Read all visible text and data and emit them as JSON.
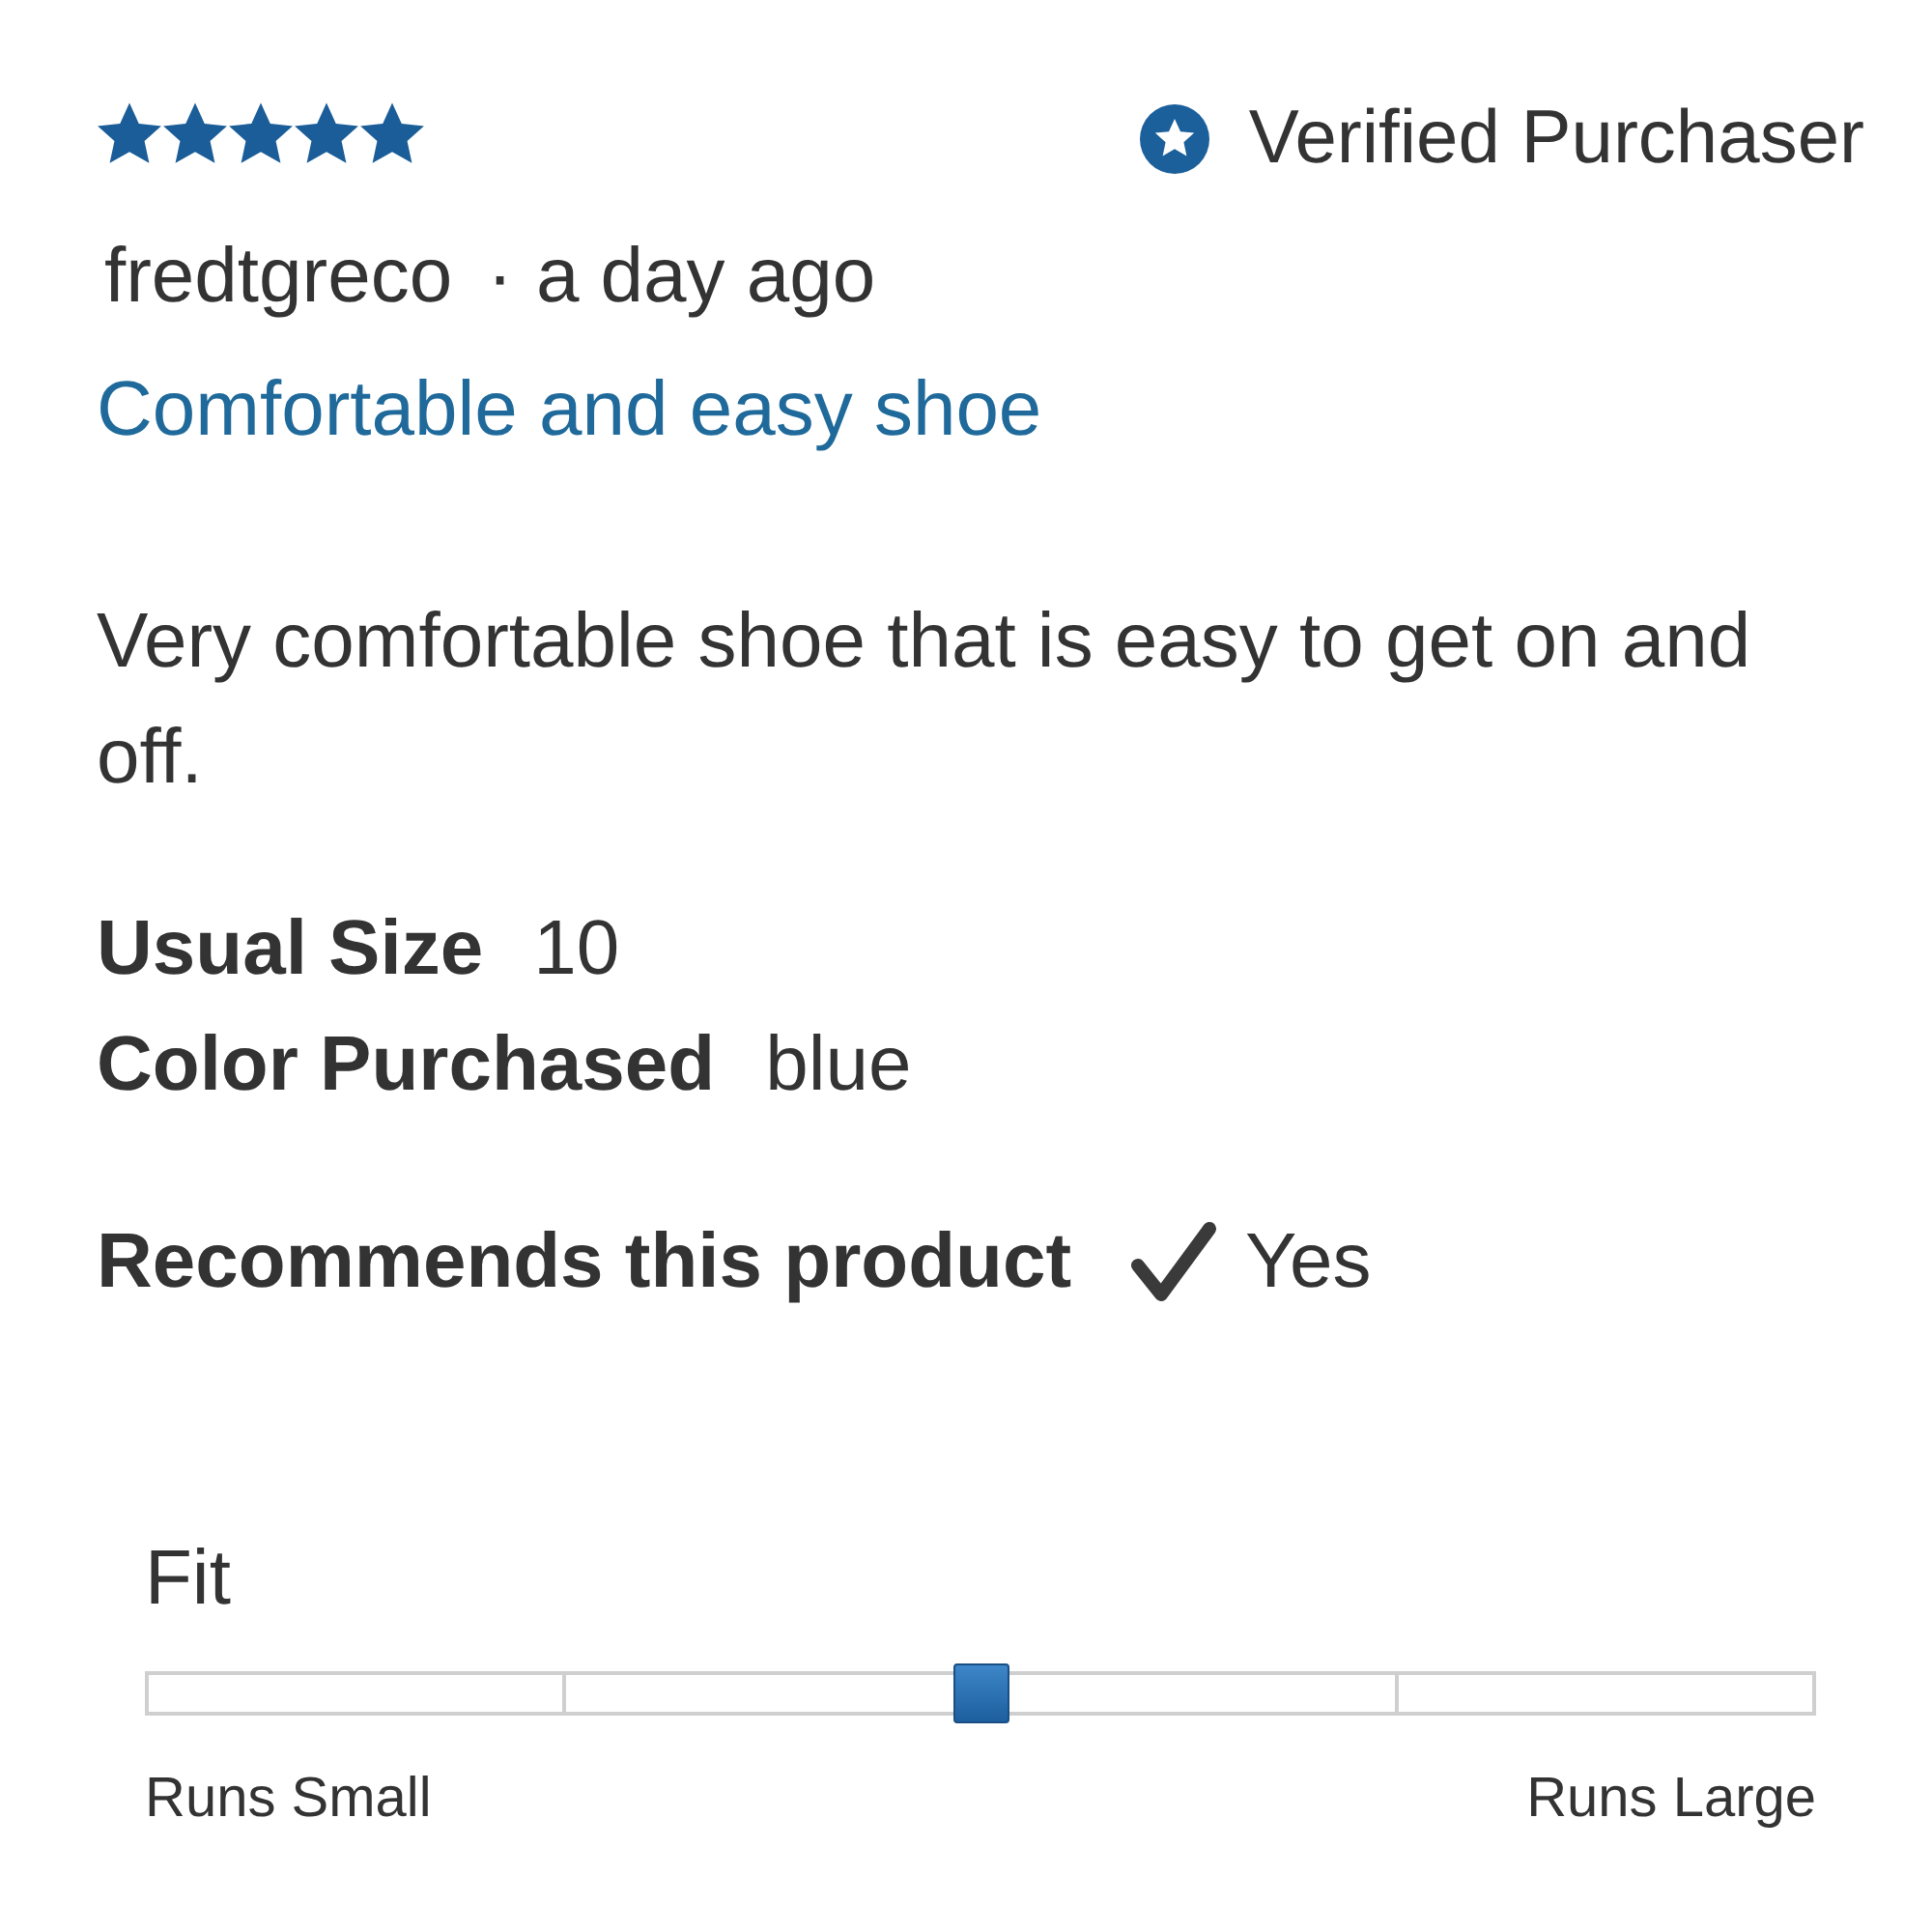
{
  "review": {
    "stars": 5,
    "badge": {
      "label": "Verified Purchaser"
    },
    "author": "fredtgreco",
    "separator": "·",
    "time": "a day ago",
    "title": "Comfortable and easy shoe",
    "body": "Very comfortable shoe that is easy to get on and off."
  },
  "attributes": [
    {
      "label": "Usual Size",
      "value": "10"
    },
    {
      "label": "Color Purchased",
      "value": "blue"
    }
  ],
  "recommendation": {
    "label": "Recommends this product",
    "recommended": true,
    "answer": "Yes"
  },
  "fit": {
    "label": "Fit",
    "level": 0.5,
    "min_label": "Runs Small",
    "max_label": "Runs Large"
  }
}
